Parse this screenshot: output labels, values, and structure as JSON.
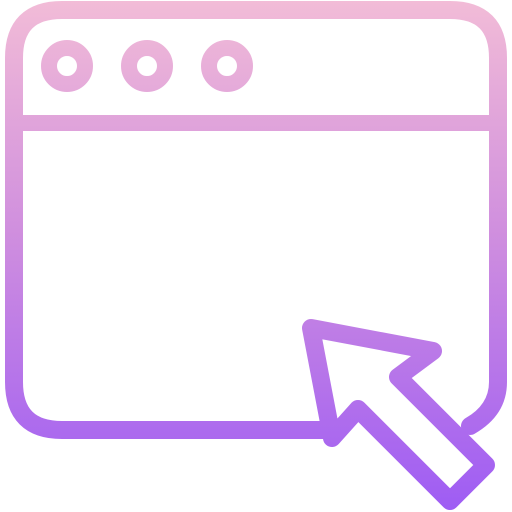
{
  "icon": {
    "name": "browser-window-with-cursor-icon",
    "gradient": {
      "top_color": "#F2BCD7",
      "middle_color": "#D08FDE",
      "bottom_color": "#9E5CF4"
    },
    "window_controls": [
      {
        "name": "window-control-dot-1"
      },
      {
        "name": "window-control-dot-2"
      },
      {
        "name": "window-control-dot-3"
      }
    ],
    "cursor": {
      "name": "arrow-cursor-icon"
    }
  }
}
